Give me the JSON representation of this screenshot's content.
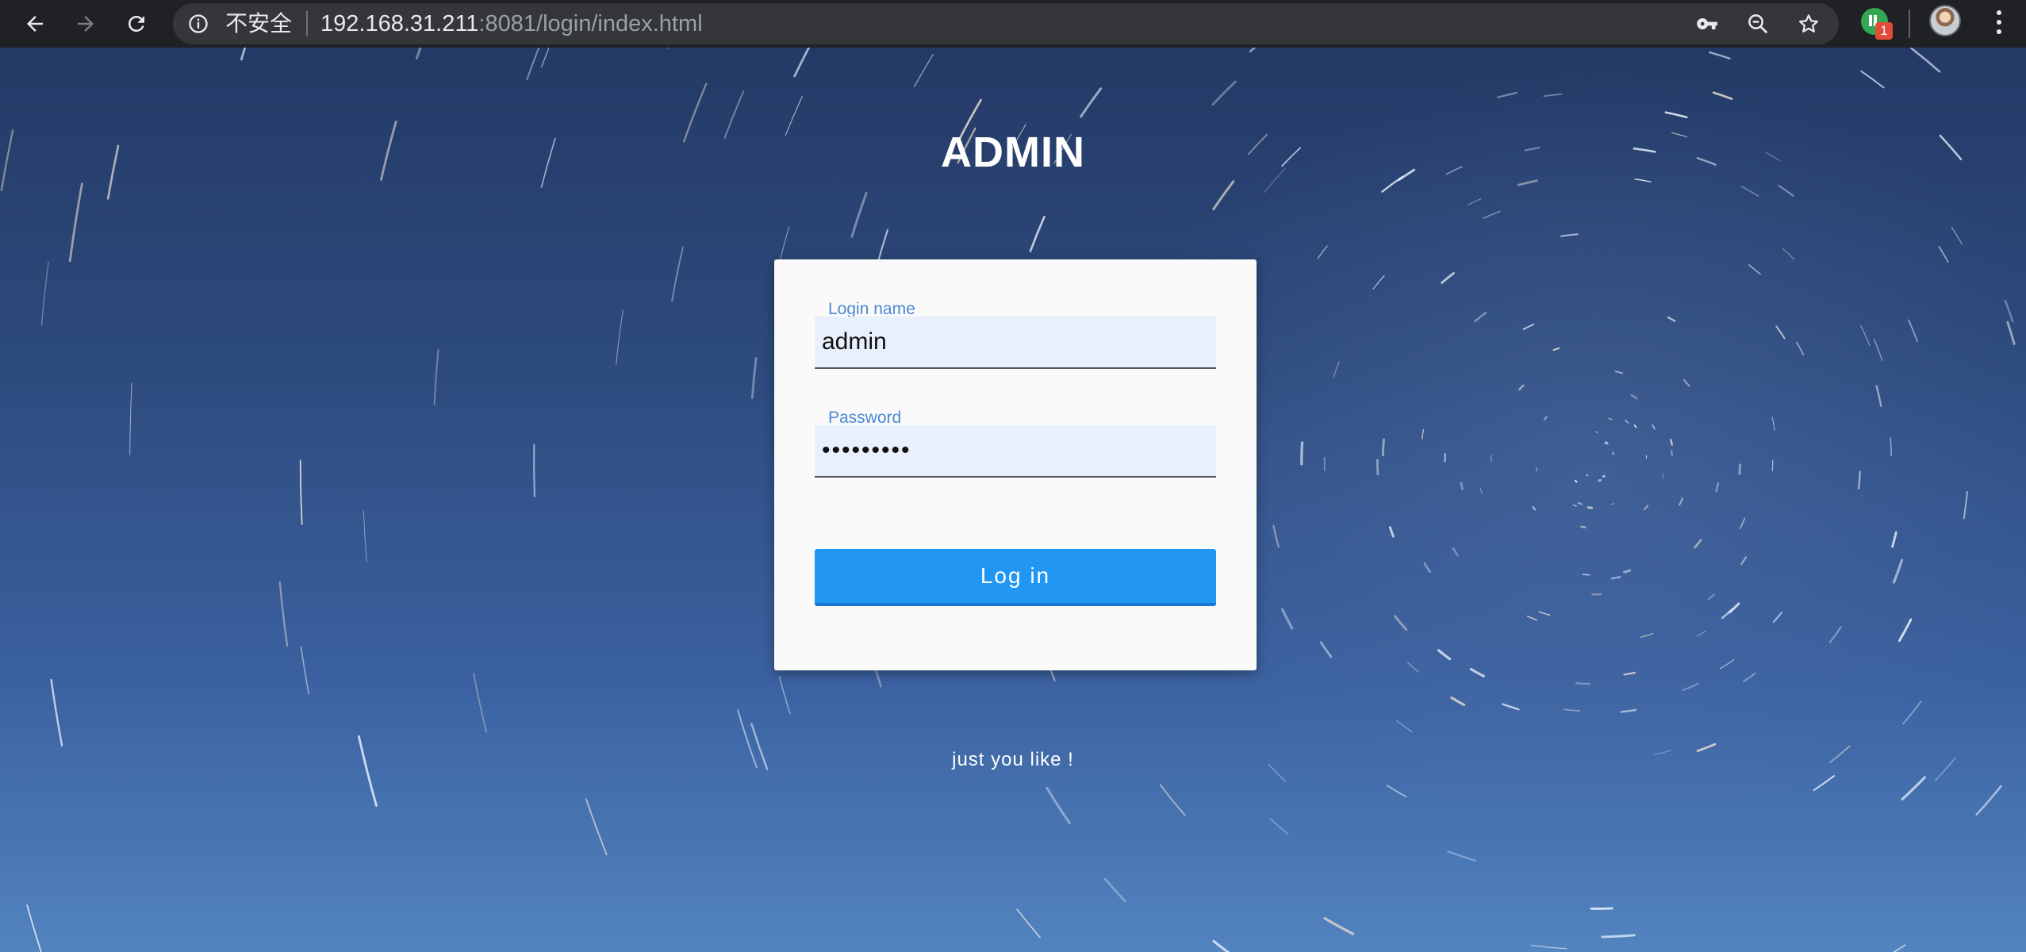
{
  "browser": {
    "security_label": "不安全",
    "url_host": "192.168.31.211",
    "url_rest": ":8081/login/index.html",
    "extension_badge": "1",
    "icons": [
      "back-icon",
      "forward-icon",
      "reload-icon",
      "info-icon",
      "key-icon",
      "zoom-out-icon",
      "star-icon",
      "extension-icon",
      "avatar",
      "menu-icon"
    ]
  },
  "page": {
    "title": "ADMIN",
    "tagline": "just you like !"
  },
  "login_form": {
    "username_label": "Login name",
    "username_value": "admin",
    "password_label": "Password",
    "password_value": "password1",
    "submit_label": "Log in"
  },
  "colors": {
    "accent": "#2196f3",
    "label": "#4a8ad4",
    "input_bg": "#e8f0fe",
    "page_bg_top": "#243a66",
    "page_bg_bottom": "#5284c0"
  }
}
